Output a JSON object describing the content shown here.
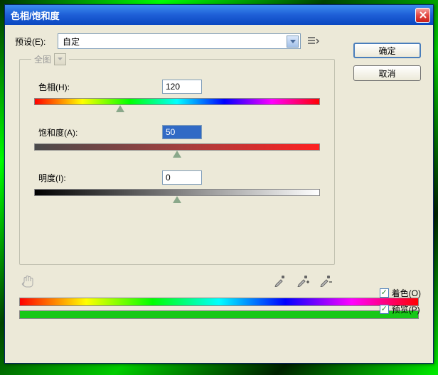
{
  "titlebar": {
    "title": "色相/饱和度"
  },
  "preset": {
    "label": "预设(E):",
    "value": "自定"
  },
  "buttons": {
    "ok": "确定",
    "cancel": "取消"
  },
  "channel": {
    "label": "全图"
  },
  "sliders": {
    "hue": {
      "label": "色相(H):",
      "value": "120",
      "pos_pct": 30
    },
    "sat": {
      "label": "饱和度(A):",
      "value": "50",
      "pos_pct": 50
    },
    "lig": {
      "label": "明度(I):",
      "value": "0",
      "pos_pct": 50
    }
  },
  "checks": {
    "colorize": {
      "label": "着色(O)",
      "checked": true
    },
    "preview": {
      "label": "预览(P)",
      "checked": true
    }
  },
  "colors": {
    "titlebar_start": "#3B8CEF",
    "titlebar_end": "#0A47C0",
    "panel": "#ECE9D8"
  }
}
